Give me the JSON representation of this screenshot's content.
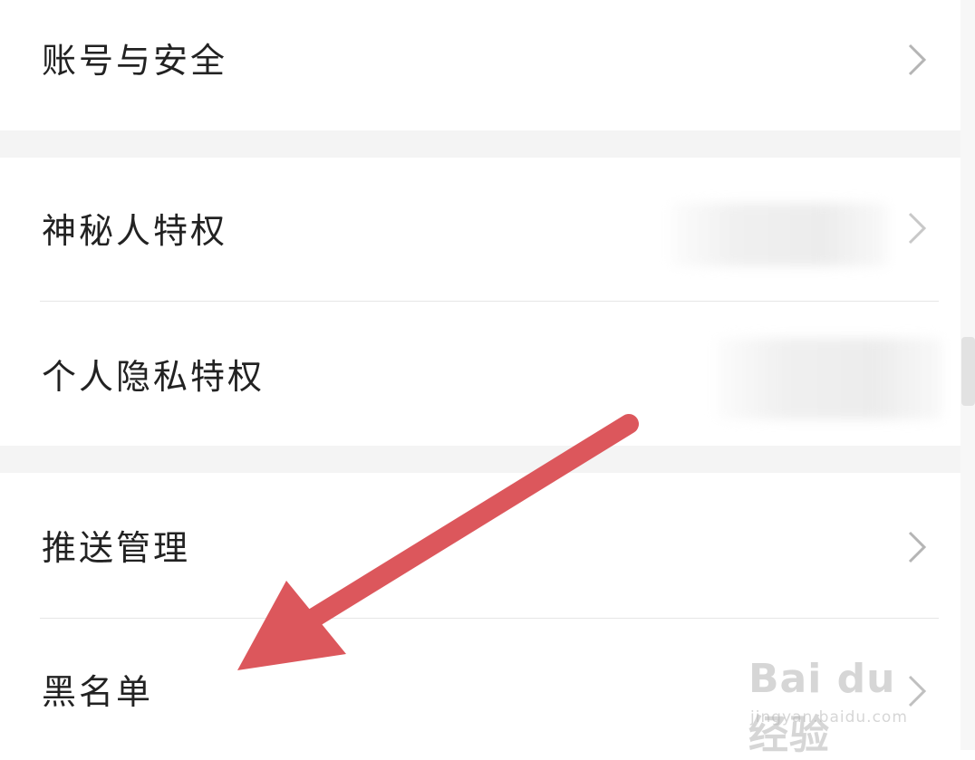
{
  "settings": {
    "items": [
      {
        "label": "账号与安全"
      },
      {
        "label": "神秘人特权"
      },
      {
        "label": "个人隐私特权"
      },
      {
        "label": "推送管理"
      },
      {
        "label": "黑名单"
      }
    ]
  },
  "annotation": {
    "arrow_color": "#dc575c",
    "points_to": "黑名单"
  },
  "watermark": {
    "main": "Bai du 经验",
    "sub": "jingyan.baidu.com"
  },
  "colors": {
    "text": "#222222",
    "chevron": "#b5b5b5",
    "section_gap": "#f4f4f4",
    "divider": "#e6e6e6"
  },
  "icons": {
    "chevron": "chevron-right-icon"
  }
}
